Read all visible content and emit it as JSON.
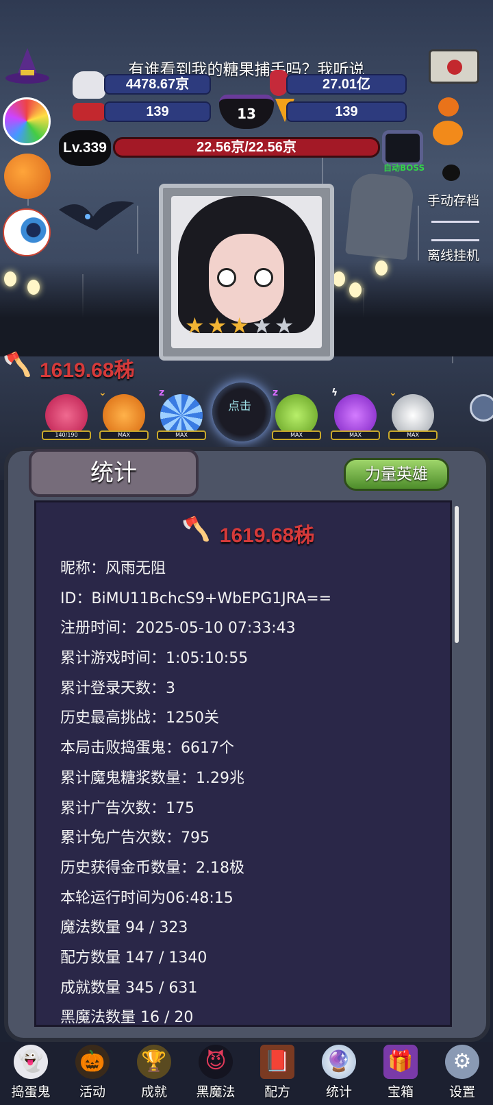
{
  "marquee": "有谁看到我的糖果捕手吗？我听说",
  "resources": {
    "candy": "4478.67京",
    "potion": "27.01亿",
    "ghosts": "139",
    "cauldron_level": "13",
    "candy_corn": "139"
  },
  "level": "Lv.339",
  "hp": "22.56京/22.56京",
  "auto_boss_label": "自动BOSS",
  "side_right": {
    "manual_save": "手动存档",
    "offline_idle": "离线挂机"
  },
  "damage": "1619.68秭",
  "hero_row": {
    "click_label": "点击",
    "heroes": [
      {
        "name": "pink-skull-hero",
        "status": "140/190",
        "color": "#e23a6a"
      },
      {
        "name": "orange-skull-hero",
        "status": "MAX",
        "color": "#ef8a1f"
      },
      {
        "name": "blue-candy-hero",
        "status": "MAX",
        "color": "#3a7be2"
      },
      {
        "name": "green-zombie-hero",
        "status": "MAX",
        "color": "#8fcf3a"
      },
      {
        "name": "purple-ghost-hero",
        "status": "MAX",
        "color": "#a23ae2"
      },
      {
        "name": "white-skull-hero",
        "status": "MAX",
        "color": "#e8e8e8"
      }
    ]
  },
  "panel": {
    "tab_title": "统计",
    "power_hero_button": "力量英雄",
    "damage": "1619.68秭",
    "stats": [
      "昵称：风雨无阻",
      "ID：BiMU11BchcS9+WbEPG1JRA==",
      "注册时间：2025-05-10 07:33:43",
      "累计游戏时间：1:05:10:55",
      "累计登录天数：3",
      "历史最高挑战：1250关",
      "本局击败捣蛋鬼：6617个",
      "累计魔鬼糖浆数量：1.29兆",
      "累计广告次数：175",
      "累计免广告次数：795",
      "历史获得金币数量：2.18极",
      "本轮运行时间为06:48:15",
      "魔法数量 94 / 323",
      "配方数量 147 / 1340",
      "成就数量 345 / 631",
      "黑魔法数量 16 / 20"
    ]
  },
  "nav": [
    {
      "label": "捣蛋鬼",
      "icon": "ghost-icon"
    },
    {
      "label": "活动",
      "icon": "event-icon"
    },
    {
      "label": "成就",
      "icon": "trophy-icon"
    },
    {
      "label": "黑魔法",
      "icon": "dark-magic-icon"
    },
    {
      "label": "配方",
      "icon": "recipe-book-icon"
    },
    {
      "label": "统计",
      "icon": "crystal-ball-icon"
    },
    {
      "label": "宝箱",
      "icon": "chest-icon"
    },
    {
      "label": "设置",
      "icon": "gear-icon"
    }
  ],
  "colors": {
    "hp_bar": "#a31926",
    "damage_text": "#d63a3a",
    "power_button": "#6fb040",
    "panel_bg": "#2a2748"
  }
}
